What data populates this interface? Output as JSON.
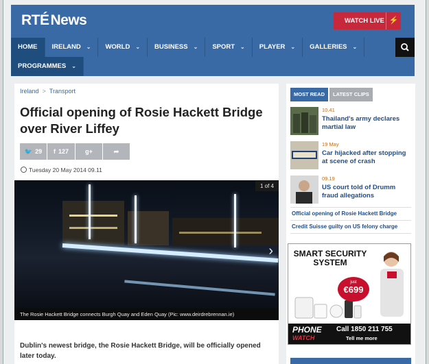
{
  "header": {
    "logo_rte": "RTÉ",
    "logo_news": "News",
    "watch_live": "WATCH LIVE",
    "brand_color": "#3a6aa5",
    "accent_color": "#c8283b"
  },
  "nav": {
    "items": [
      {
        "label": "HOME"
      },
      {
        "label": "IRELAND"
      },
      {
        "label": "WORLD"
      },
      {
        "label": "BUSINESS"
      },
      {
        "label": "SPORT"
      },
      {
        "label": "PLAYER"
      },
      {
        "label": "GALLERIES"
      }
    ],
    "row2": [
      {
        "label": "PROGRAMMES"
      }
    ],
    "search_icon": "search-icon"
  },
  "article": {
    "breadcrumb": [
      "Ireland",
      "Transport"
    ],
    "title": "Official opening of Rosie Hackett Bridge over River Liffey",
    "share": {
      "twitter_count": "29",
      "facebook_count": "127"
    },
    "date": "Tuesday 20 May 2014 09.11",
    "photo": {
      "counter": "1 of 4",
      "caption": "The Rosie Hackett Bridge connects Burgh Quay and Eden Quay (Pic: www.deirdrebrennan.ie)"
    },
    "lead": "Dublin's newest bridge, the Rosie Hackett Bridge, will be officially opened later today."
  },
  "sidebar": {
    "tabs": [
      "MOST READ",
      "LATEST CLIPS"
    ],
    "stories": [
      {
        "time": "10.41",
        "headline": "Thailand's army declares martial law"
      },
      {
        "time": "19 May",
        "headline": "Car hijacked after stopping at scene of crash"
      },
      {
        "time": "09.19",
        "headline": "US court told of Drumm fraud allegations"
      }
    ],
    "links": [
      "Official opening of Rosie Hackett Bridge",
      "Credit Suisse guilty on US felony charge"
    ],
    "ad": {
      "title": "SMART SECURITY SYSTEM",
      "just": "just",
      "price": "€699",
      "brand_phone": "PHONE",
      "brand_watch": "WATCH",
      "call": "Call 1850 211 755",
      "more": "Tell me more"
    }
  }
}
